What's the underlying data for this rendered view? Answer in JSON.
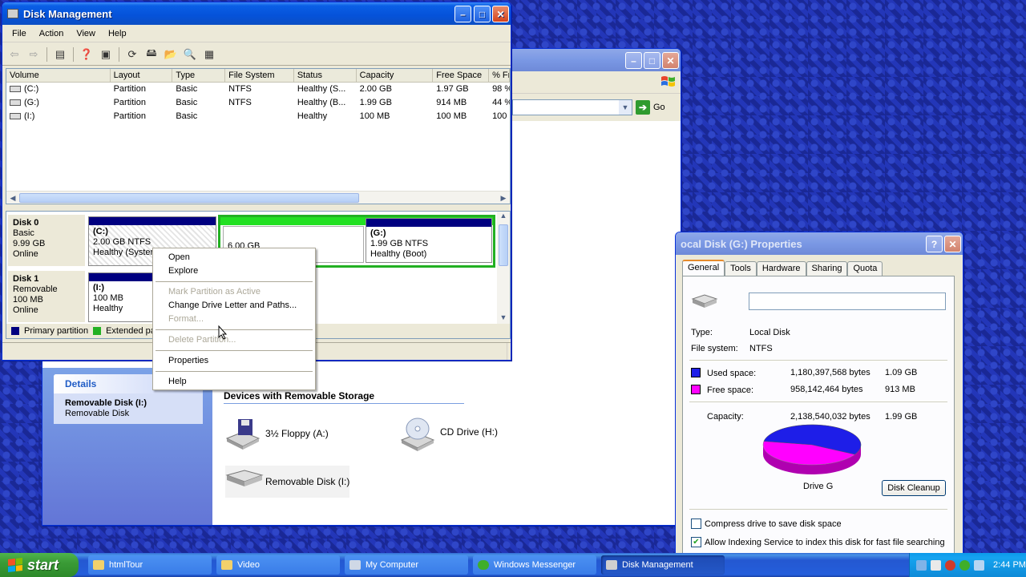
{
  "disk_mgmt": {
    "title": "Disk Management",
    "menu": [
      "File",
      "Action",
      "View",
      "Help"
    ],
    "columns": [
      "Volume",
      "Layout",
      "Type",
      "File System",
      "Status",
      "Capacity",
      "Free Space",
      "% Fr"
    ],
    "rows": [
      [
        "(C:)",
        "Partition",
        "Basic",
        "NTFS",
        "Healthy (S...",
        "2.00 GB",
        "1.97 GB",
        "98 %"
      ],
      [
        "(G:)",
        "Partition",
        "Basic",
        "NTFS",
        "Healthy (B...",
        "1.99 GB",
        "914 MB",
        "44 %"
      ],
      [
        "(I:)",
        "Partition",
        "Basic",
        "",
        "Healthy",
        "100 MB",
        "100 MB",
        "100 "
      ]
    ],
    "disk0": {
      "name": "Disk 0",
      "type": "Basic",
      "size": "9.99 GB",
      "state": "Online"
    },
    "disk1": {
      "name": "Disk 1",
      "type": "Removable",
      "size": "100 MB",
      "state": "Online"
    },
    "part_c": {
      "name": "(C:)",
      "size": "2.00 GB NTFS",
      "status": "Healthy (System)"
    },
    "part_free": {
      "size": "6.00 GB"
    },
    "part_g": {
      "name": "(G:)",
      "size": "1.99 GB NTFS",
      "status": "Healthy (Boot)"
    },
    "part_i": {
      "name": "(I:)",
      "size": "100 MB",
      "status": "Healthy"
    },
    "legend": {
      "primary": "Primary partition",
      "extended": "Extended partit"
    },
    "colors": {
      "primary": "#000080",
      "extended": "#22b022"
    }
  },
  "context_menu": {
    "open": "Open",
    "explore": "Explore",
    "mark_active": "Mark Partition as Active",
    "change_letter": "Change Drive Letter and Paths...",
    "format": "Format...",
    "delete": "Delete Partition...",
    "properties": "Properties",
    "help": "Help"
  },
  "my_computer": {
    "go": "Go",
    "details_title": "Details",
    "details_name": "Removable Disk (I:)",
    "details_type": "Removable Disk",
    "devices_title": "Devices with Removable Storage",
    "floppy": "3½ Floppy (A:)",
    "cd": "CD Drive (H:)",
    "removable": "Removable Disk (I:)"
  },
  "props": {
    "title": "ocal Disk (G:) Properties",
    "tabs": [
      "General",
      "Tools",
      "Hardware",
      "Sharing",
      "Quota"
    ],
    "label_value": "",
    "type_label": "Type:",
    "type_value": "Local Disk",
    "fs_label": "File system:",
    "fs_value": "NTFS",
    "used_label": "Used space:",
    "used_bytes": "1,180,397,568 bytes",
    "used_gb": "1.09 GB",
    "free_label": "Free space:",
    "free_bytes": "958,142,464 bytes",
    "free_mb": "913 MB",
    "cap_label": "Capacity:",
    "cap_bytes": "2,138,540,032 bytes",
    "cap_gb": "1.99 GB",
    "drive_label": "Drive G",
    "cleanup": "Disk Cleanup",
    "compress": "Compress drive to save disk space",
    "index": "Allow Indexing Service to index this disk for fast file searching",
    "used_fraction": 0.552,
    "colors": {
      "used": "#1e1ee8",
      "free": "#ff00ff"
    }
  },
  "taskbar": {
    "start": "start",
    "tasks": [
      "htmlTour",
      "Video",
      "My Computer",
      "Windows Messenger",
      "Disk Management"
    ],
    "clock": "2:44 PM"
  }
}
